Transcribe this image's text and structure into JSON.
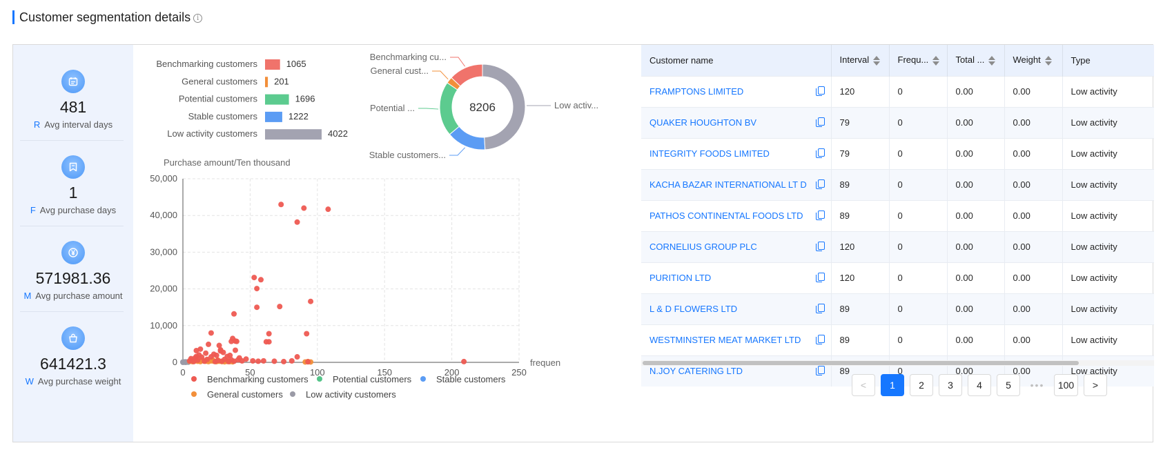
{
  "header": {
    "title": "Customer segmentation details",
    "info_icon": "info-icon"
  },
  "metrics": [
    {
      "icon": "calendar-icon",
      "value": "481",
      "letter": "R",
      "label": "Avg interval days"
    },
    {
      "icon": "bookmark-icon",
      "value": "1",
      "letter": "F",
      "label": "Avg purchase days"
    },
    {
      "icon": "yen-icon",
      "value": "571981.36",
      "letter": "M",
      "label": "Avg purchase amount"
    },
    {
      "icon": "bag-icon",
      "value": "641421.3",
      "letter": "W",
      "label": "Avg purchase weight"
    }
  ],
  "chart_data": [
    {
      "type": "bar",
      "orientation": "horizontal",
      "categories": [
        "Benchmarking customers",
        "General customers",
        "Potential customers",
        "Stable customers",
        "Low activity customers"
      ],
      "values": [
        1065,
        201,
        1696,
        1222,
        4022
      ],
      "colors": [
        "#f0736b",
        "#f28f3a",
        "#5ccb8f",
        "#5b9cf4",
        "#a3a3b1"
      ]
    },
    {
      "type": "pie",
      "donut": true,
      "center_label": "8206",
      "slices": [
        {
          "label": "Benchmarking cu...",
          "value": 1065,
          "color": "#f0736b"
        },
        {
          "label": "General cust...",
          "value": 201,
          "color": "#f28f3a"
        },
        {
          "label": "Potential ...",
          "value": 1696,
          "color": "#5ccb8f"
        },
        {
          "label": "Stable customers...",
          "value": 1222,
          "color": "#5b9cf4"
        },
        {
          "label": "Low activ...",
          "value": 4022,
          "color": "#a3a3b1"
        }
      ]
    },
    {
      "type": "scatter",
      "ylabel": "Purchase amount/Ten thousand",
      "xlabel": "frequen",
      "xlim": [
        0,
        250
      ],
      "ylim": [
        0,
        50000
      ],
      "xticks": [
        "0",
        "50",
        "100",
        "150",
        "200",
        "250"
      ],
      "yticks": [
        "0",
        "10,000",
        "20,000",
        "30,000",
        "40,000",
        "50,000"
      ],
      "grid": true,
      "legend": "bottom",
      "series": [
        {
          "name": "Benchmarking customers",
          "color": "#ee5a52",
          "points": [
            [
              73,
              43000
            ],
            [
              90,
              42000
            ],
            [
              108,
              41700
            ],
            [
              85,
              38200
            ],
            [
              53,
              23100
            ],
            [
              58,
              22500
            ],
            [
              55,
              20100
            ],
            [
              95,
              16600
            ],
            [
              55,
              15000
            ],
            [
              72,
              15200
            ],
            [
              38,
              13200
            ],
            [
              92,
              7800
            ],
            [
              37,
              6500
            ],
            [
              39,
              5800
            ],
            [
              21,
              8000
            ],
            [
              19,
              4900
            ],
            [
              27,
              4600
            ],
            [
              62,
              5600
            ],
            [
              64,
              7800
            ],
            [
              64,
              5600
            ],
            [
              36,
              5700
            ],
            [
              40,
              5700
            ],
            [
              28,
              3400
            ],
            [
              28,
              3100
            ],
            [
              13,
              3600
            ],
            [
              10,
              3200
            ],
            [
              39,
              3300
            ],
            [
              25,
              1900
            ],
            [
              33,
              1600
            ],
            [
              85,
              1500
            ],
            [
              6,
              1000
            ],
            [
              10,
              1600
            ],
            [
              14,
              1400
            ],
            [
              21,
              1500
            ],
            [
              31,
              800
            ],
            [
              36,
              700
            ],
            [
              41,
              700
            ],
            [
              47,
              900
            ],
            [
              52,
              400
            ],
            [
              56,
              300
            ],
            [
              60,
              400
            ],
            [
              68,
              300
            ],
            [
              75,
              200
            ],
            [
              81,
              400
            ],
            [
              5,
              400
            ],
            [
              8,
              200
            ],
            [
              16,
              300
            ],
            [
              24,
              200
            ],
            [
              26,
              500
            ],
            [
              29,
              300
            ],
            [
              34,
              200
            ],
            [
              38,
              300
            ],
            [
              44,
              400
            ],
            [
              209,
              200
            ],
            [
              93,
              150
            ],
            [
              12,
              2000
            ],
            [
              17,
              2500
            ],
            [
              23,
              2200
            ],
            [
              30,
              2700
            ],
            [
              35,
              1900
            ],
            [
              42,
              1200
            ],
            [
              11,
              600
            ],
            [
              18,
              800
            ],
            [
              9,
              1200
            ]
          ]
        },
        {
          "name": "Potential customers",
          "color": "#55c489",
          "points": []
        },
        {
          "name": "Stable customers",
          "color": "#5b9cf4",
          "points": []
        },
        {
          "name": "General customers",
          "color": "#f28f3a",
          "points": [
            [
              5,
              300
            ],
            [
              7,
              200
            ],
            [
              9,
              400
            ],
            [
              11,
              300
            ],
            [
              13,
              200
            ],
            [
              15,
              500
            ],
            [
              17,
              300
            ],
            [
              19,
              200
            ],
            [
              21,
              400
            ],
            [
              23,
              300
            ],
            [
              25,
              200
            ],
            [
              27,
              300
            ],
            [
              29,
              200
            ],
            [
              31,
              150
            ],
            [
              33,
              250
            ],
            [
              35,
              200
            ],
            [
              37,
              150
            ],
            [
              6,
              600
            ],
            [
              10,
              700
            ],
            [
              14,
              600
            ],
            [
              18,
              500
            ],
            [
              22,
              700
            ],
            [
              26,
              600
            ],
            [
              91,
              100
            ],
            [
              93,
              200
            ],
            [
              95,
              100
            ]
          ]
        },
        {
          "name": "Low activity customers",
          "color": "#9a9aa6",
          "points": [
            [
              0,
              0
            ],
            [
              1,
              50
            ],
            [
              2,
              0
            ],
            [
              3,
              80
            ],
            [
              1,
              120
            ],
            [
              2,
              150
            ],
            [
              0,
              100
            ],
            [
              4,
              40
            ]
          ]
        }
      ]
    }
  ],
  "table": {
    "columns": [
      {
        "label": "Customer name",
        "sortable": false
      },
      {
        "label": "Interval",
        "sortable": true
      },
      {
        "label": "Frequ...",
        "sortable": true
      },
      {
        "label": "Total ...",
        "sortable": true
      },
      {
        "label": "Weight",
        "sortable": true
      },
      {
        "label": "Type",
        "sortable": false
      }
    ],
    "rows": [
      [
        "FRAMPTONS LIMITED",
        "120",
        "0",
        "0.00",
        "0.00",
        "Low activity"
      ],
      [
        "QUAKER HOUGHTON BV",
        "79",
        "0",
        "0.00",
        "0.00",
        "Low activity"
      ],
      [
        "INTEGRITY FOODS LIMITED",
        "79",
        "0",
        "0.00",
        "0.00",
        "Low activity"
      ],
      [
        "KACHA BAZAR INTERNATIONAL LT D",
        "89",
        "0",
        "0.00",
        "0.00",
        "Low activity"
      ],
      [
        "PATHOS CONTINENTAL FOODS LTD",
        "89",
        "0",
        "0.00",
        "0.00",
        "Low activity"
      ],
      [
        "CORNELIUS GROUP PLC",
        "120",
        "0",
        "0.00",
        "0.00",
        "Low activity"
      ],
      [
        "PURITION LTD",
        "120",
        "0",
        "0.00",
        "0.00",
        "Low activity"
      ],
      [
        "L & D FLOWERS LTD",
        "89",
        "0",
        "0.00",
        "0.00",
        "Low activity"
      ],
      [
        "WESTMINSTER MEAT MARKET LTD",
        "89",
        "0",
        "0.00",
        "0.00",
        "Low activity"
      ],
      [
        "N.JOY CATERING LTD",
        "89",
        "0",
        "0.00",
        "0.00",
        "Low activity"
      ]
    ]
  },
  "pagination": {
    "prev": "<",
    "next": ">",
    "pages": [
      "1",
      "2",
      "3",
      "4",
      "5"
    ],
    "ellipsis": "•••",
    "last": "100",
    "current": "1"
  }
}
